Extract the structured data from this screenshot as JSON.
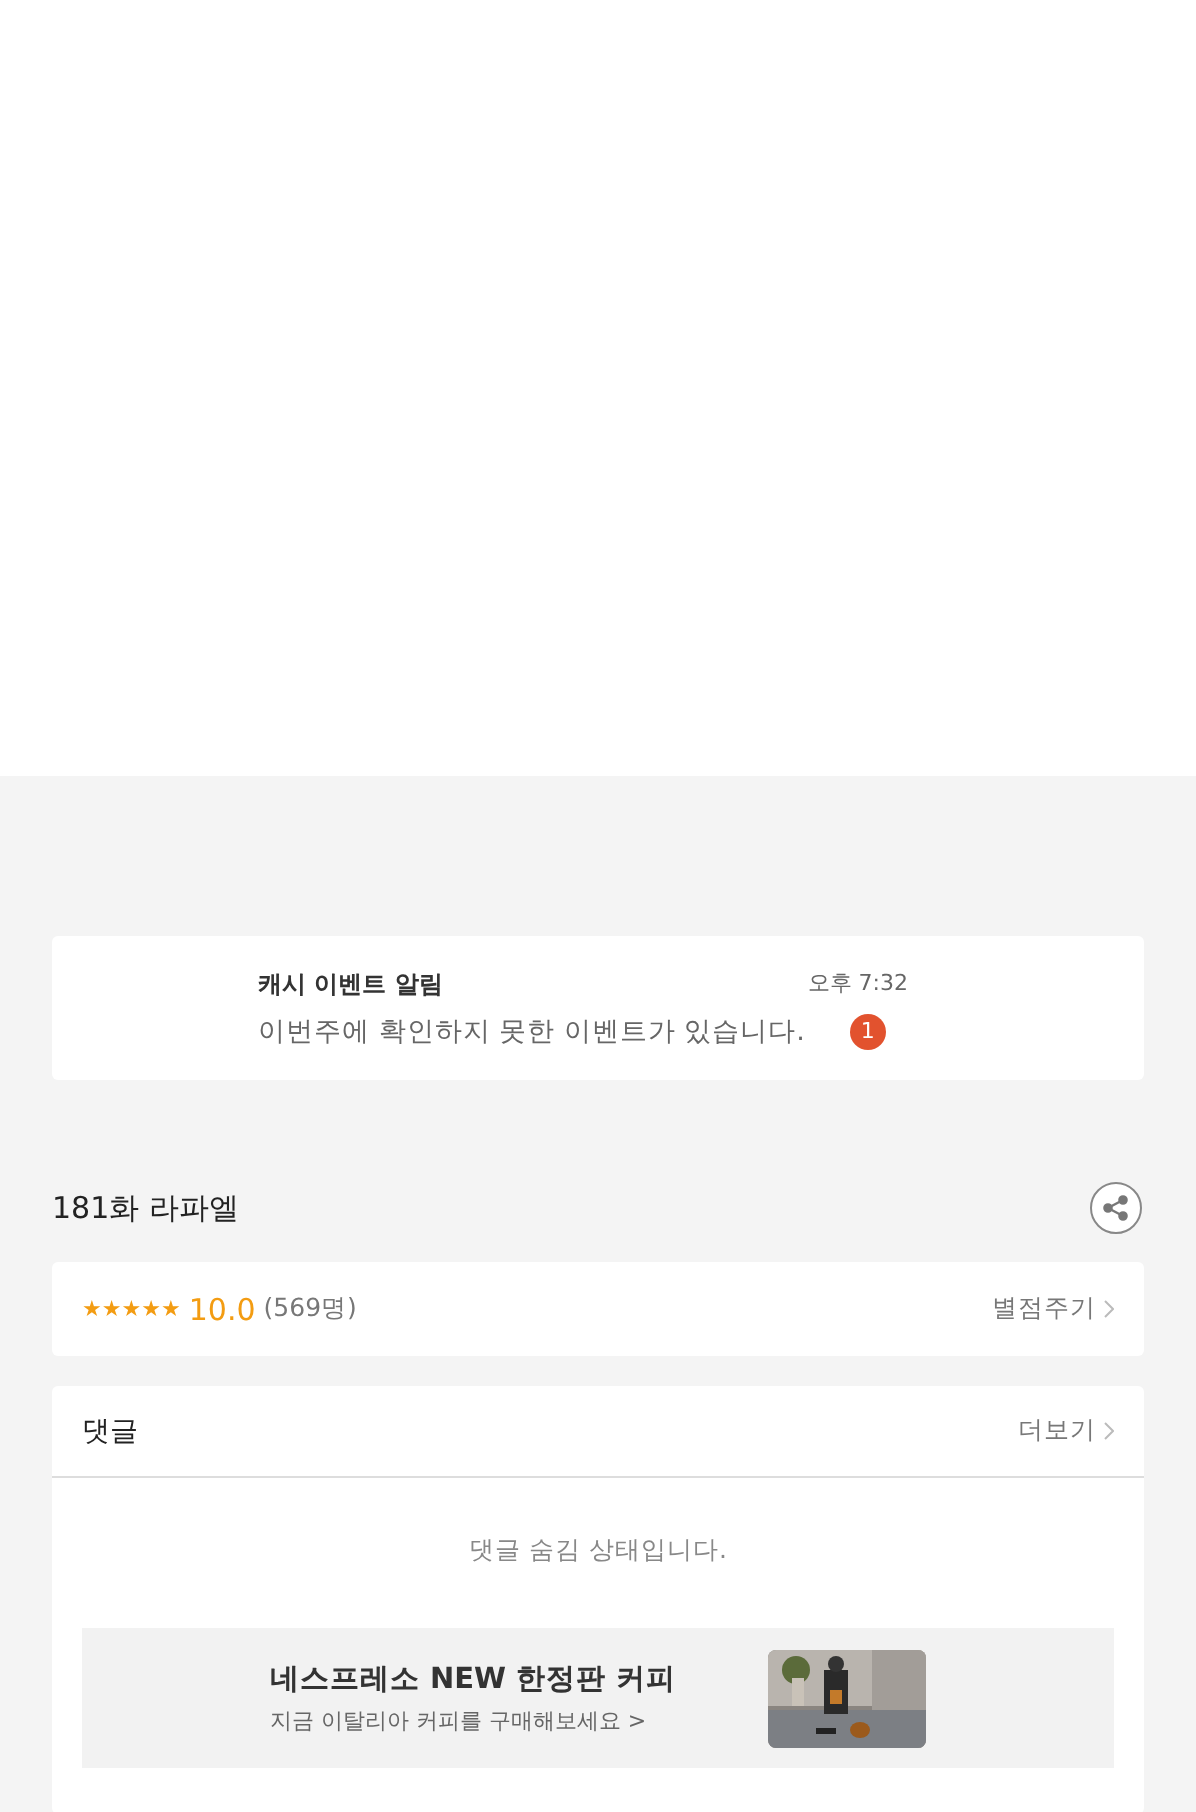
{
  "notification": {
    "title": "캐시 이벤트 알림",
    "message": "이번주에 확인하지 못한 이벤트가 있습니다.",
    "time": "오후 7:32",
    "badge": "1"
  },
  "episode": {
    "title": "181화 라파엘"
  },
  "rating": {
    "stars": 5,
    "score": "10.0",
    "count": "(569명)",
    "action": "별점주기"
  },
  "comments": {
    "title": "댓글",
    "more": "더보기",
    "status": "댓글 숨김 상태입니다."
  },
  "ad": {
    "kind": "picture",
    "headline": "네스프레소 NEW 한정판 커피",
    "subline": "지금 이탈리아 커피를 구매해보세요 >"
  }
}
